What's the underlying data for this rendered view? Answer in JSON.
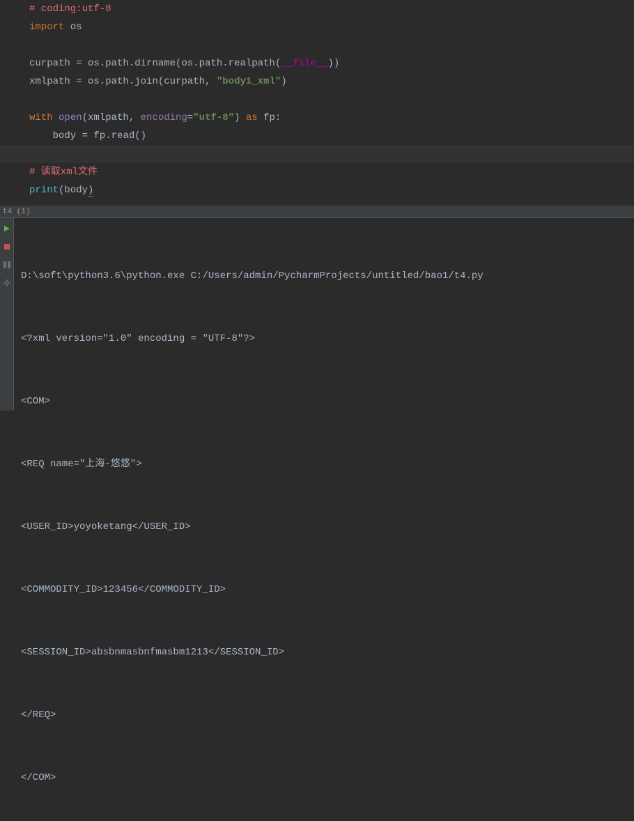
{
  "code": {
    "line1_comment": "# coding:utf-8",
    "line2_import": "import",
    "line2_os": " os",
    "line4_curpath": "curpath ",
    "line4_eq": "=",
    "line4_rest": " os.path.dirname(os.path.realpath(",
    "line4_file": "__file__",
    "line4_end": "))",
    "line5_xmlpath": "xmlpath ",
    "line5_eq": "=",
    "line5_rest": " os.path.join(curpath, ",
    "line5_str": "\"body1_xml\"",
    "line5_end": ")",
    "line7_with": "with",
    "line7_space": " ",
    "line7_open": "open",
    "line7_paren1": "(xmlpath, ",
    "line7_enc": "encoding",
    "line7_eq": "=",
    "line7_str": "\"utf-8\"",
    "line7_paren2": ")",
    "line7_as": " as ",
    "line7_fp": "fp:",
    "line8_body": "    body ",
    "line8_eq": "=",
    "line8_rest": " fp.read()",
    "line10_comment": "# 读取xml文件",
    "line11_print": "print",
    "line11_paren1": "(",
    "line11_body": "body",
    "line11_paren2": ")"
  },
  "tab": {
    "label": "t4 (1)"
  },
  "console": {
    "line1": "D:\\soft\\python3.6\\python.exe C:/Users/admin/PycharmProjects/untitled/bao1/t4.py",
    "line2": "<?xml version=\"1.0\" encoding = \"UTF-8\"?>",
    "line3": "<COM>",
    "line4": "<REQ name=\"上海-悠悠\">",
    "line5": "<USER_ID>yoyoketang</USER_ID>",
    "line6": "<COMMODITY_ID>123456</COMMODITY_ID>",
    "line7": "<SESSION_ID>absbnmasbnfmasbm1213</SESSION_ID>",
    "line8": "</REQ>",
    "line9": "</COM>"
  }
}
